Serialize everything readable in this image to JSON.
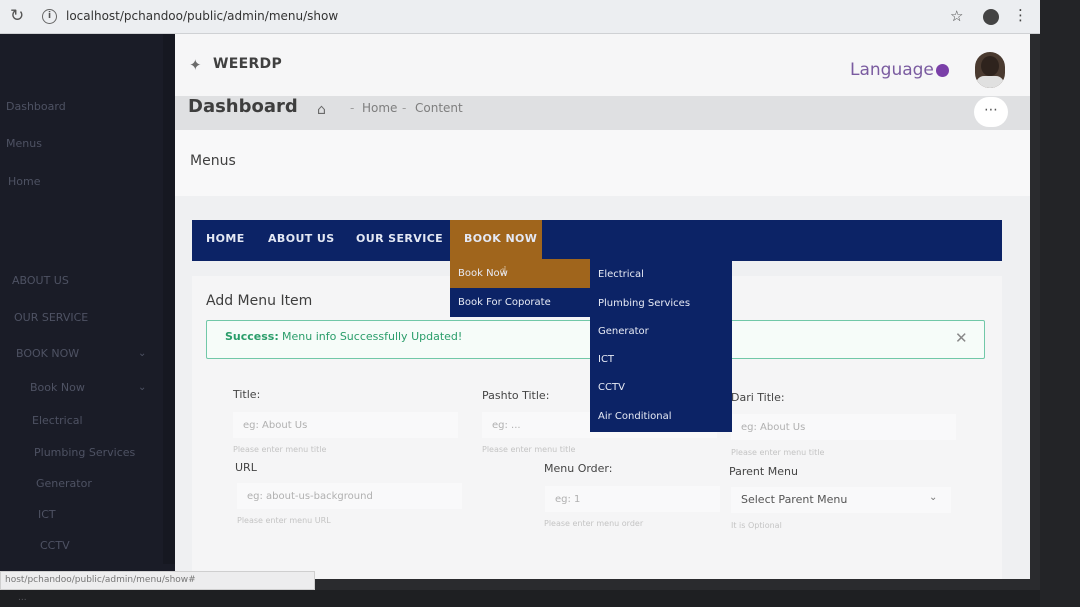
{
  "browser": {
    "url": "localhost/pchandoo/public/admin/menu/show",
    "status_url": "host/pchandoo/public/admin/menu/show#"
  },
  "icons": {
    "reload": "reload-icon",
    "info": "info-icon",
    "star": "star-icon",
    "account": "account-icon",
    "more": "more-icon",
    "logo": "logo-icon",
    "home": "home-icon",
    "globe": "globe-icon",
    "close": "close-icon",
    "chevron": "chevron-down-icon"
  },
  "colors": {
    "nav_bg": "#0c2366",
    "nav_active": "#a0651c",
    "success": "#2a9d6a",
    "sidebar_bg": "#1a1c27"
  },
  "sidebar": {
    "items": [
      {
        "label": "Dashboard"
      },
      {
        "label": "Menus"
      },
      {
        "label": "Home"
      },
      {
        "label": "ABOUT US"
      },
      {
        "label": "OUR SERVICE"
      },
      {
        "label": "BOOK NOW"
      },
      {
        "label": "Book Now"
      },
      {
        "label": "Electrical"
      },
      {
        "label": "Plumbing Services"
      },
      {
        "label": "Generator"
      },
      {
        "label": "ICT"
      },
      {
        "label": "CCTV"
      }
    ]
  },
  "header": {
    "logo_text": "WEERDP",
    "language_label": "Language"
  },
  "subheader": {
    "title": "Dashboard",
    "crumbs": [
      "Home",
      "Content"
    ]
  },
  "menus_card": {
    "title": "Menus"
  },
  "preview_nav": {
    "links": [
      "HOME",
      "ABOUT US",
      "OUR SERVICE",
      "BOOK NOW"
    ],
    "dropdown": [
      "Book Now",
      "Book For Coporate"
    ],
    "submenu": [
      "Electrical",
      "Plumbing Services",
      "Generator",
      "ICT",
      "CCTV",
      "Air Conditional"
    ]
  },
  "form": {
    "title": "Add Menu Item",
    "alert_bold": "Success:",
    "alert_message": "Menu info Successfully Updated!",
    "title_label": "Title:",
    "title_placeholder": "eg: About Us",
    "title_hint": "Please enter menu title",
    "pashto_label": "Pashto Title:",
    "pashto_placeholder": "eg: ...",
    "pashto_hint": "Please enter menu title",
    "dari_label": "Dari Title:",
    "dari_placeholder": "eg: About Us",
    "dari_hint": "Please enter menu title",
    "url_label": "URL",
    "url_placeholder": "eg: about-us-background",
    "url_hint": "Please enter menu URL",
    "order_label": "Menu Order:",
    "order_placeholder": "eg: 1",
    "order_hint": "Please enter menu order",
    "parent_label": "Parent Menu",
    "parent_value": "Select Parent Menu",
    "parent_hint": "It is Optional"
  },
  "bottom_text": "..."
}
